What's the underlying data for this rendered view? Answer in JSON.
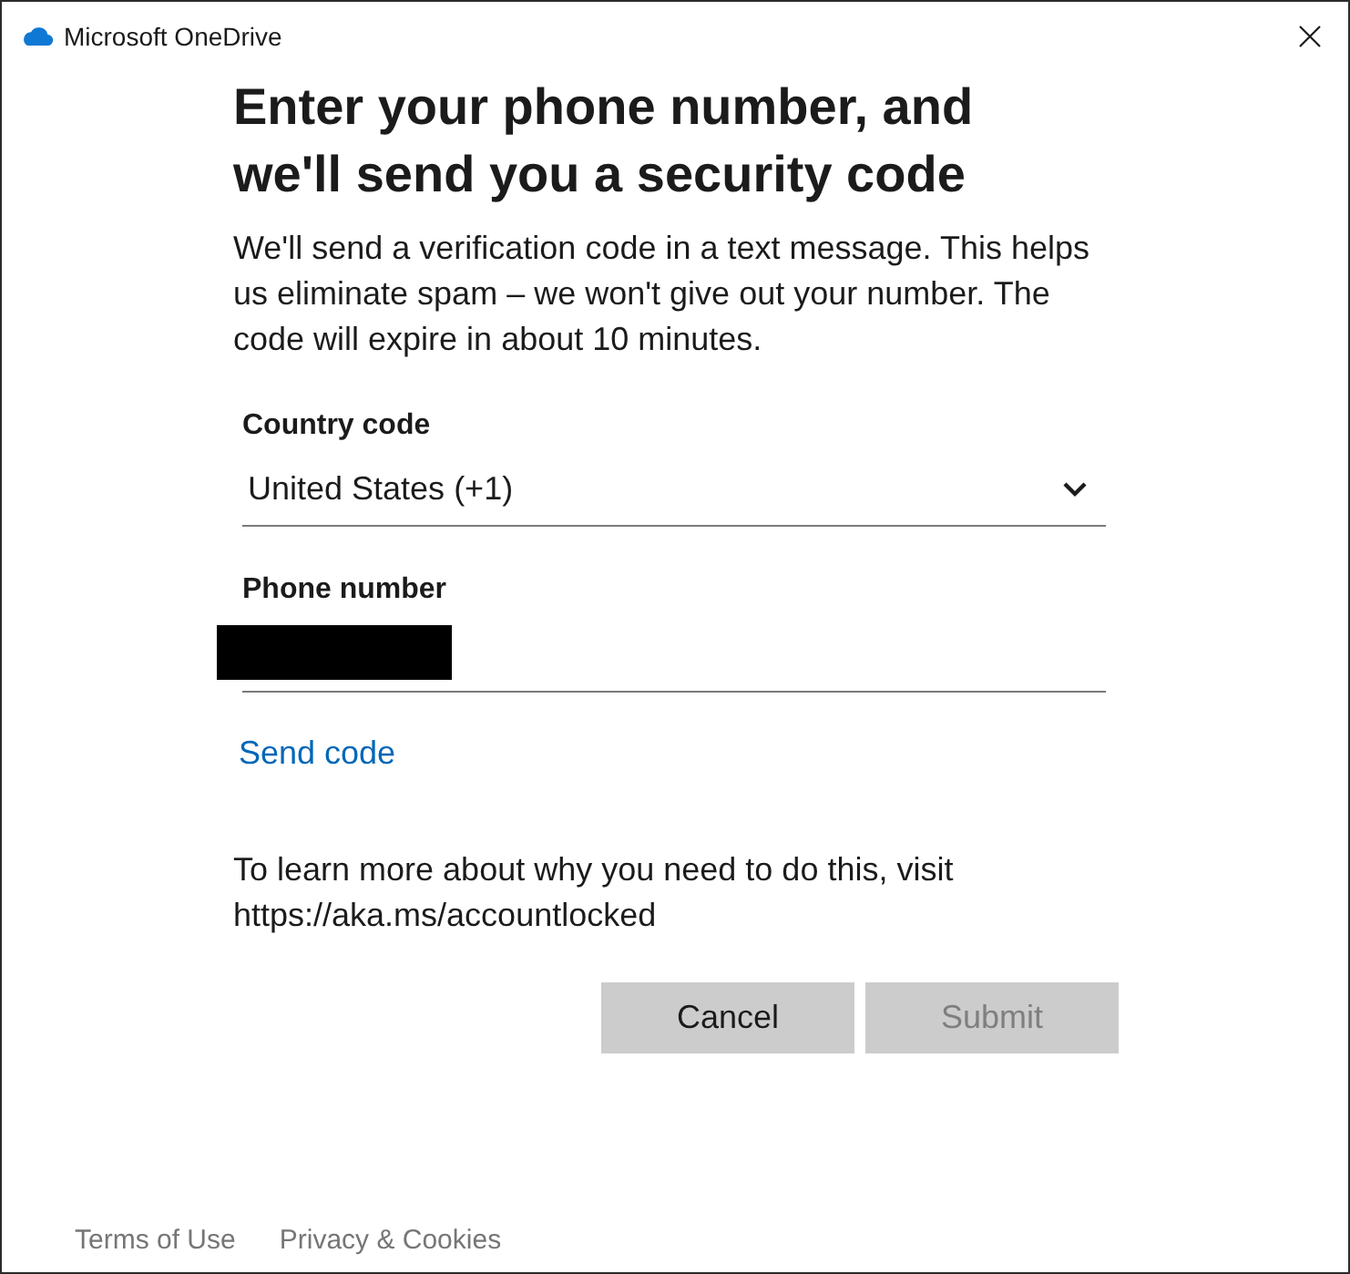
{
  "window": {
    "title": "Microsoft OneDrive"
  },
  "heading": "Enter your phone number, and we'll send you a security code",
  "description": "We'll send a verification code in a text message. This helps us eliminate spam – we won't give out your number. The code will expire in about 10 minutes.",
  "fields": [
    {
      "kind": "select",
      "label": "Country code",
      "value": "United States (+1)"
    },
    {
      "kind": "text",
      "label": "Phone number",
      "redacted": true
    }
  ],
  "send_code_link": "Send code",
  "info": "To learn more about why you need to do this, visit https://aka.ms/accountlocked",
  "buttons": [
    {
      "label": "Cancel",
      "disabled": false
    },
    {
      "label": "Submit",
      "disabled": true
    }
  ],
  "footer_links": [
    "Terms of Use",
    "Privacy & Cookies"
  ]
}
